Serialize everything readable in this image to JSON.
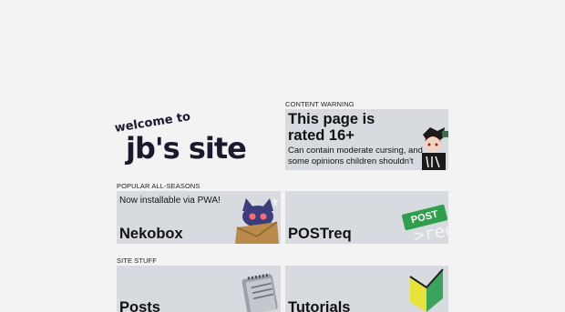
{
  "logo": {
    "welcome": "welcome to",
    "name": "jb's site"
  },
  "warning": {
    "label": "CONTENT WARNING",
    "title": "This page is rated 16+",
    "desc": "Can contain moderate cursing, and some opinions children shouldn't see"
  },
  "popular": {
    "label": "POPULAR ALL-SEASONS",
    "cards": [
      {
        "title": "Nekobox",
        "subtitle": "Now installable via PWA!"
      },
      {
        "title": "POSTreq",
        "badge": "POST",
        "overlay": ">req"
      }
    ]
  },
  "stuff": {
    "label": "SITE STUFF",
    "cards": [
      {
        "title": "Posts"
      },
      {
        "title": "Tutorials"
      }
    ]
  },
  "colors": {
    "background": "#f3f3f4",
    "card": "#d7dbe0",
    "accent_green": "#2f9e4f"
  }
}
